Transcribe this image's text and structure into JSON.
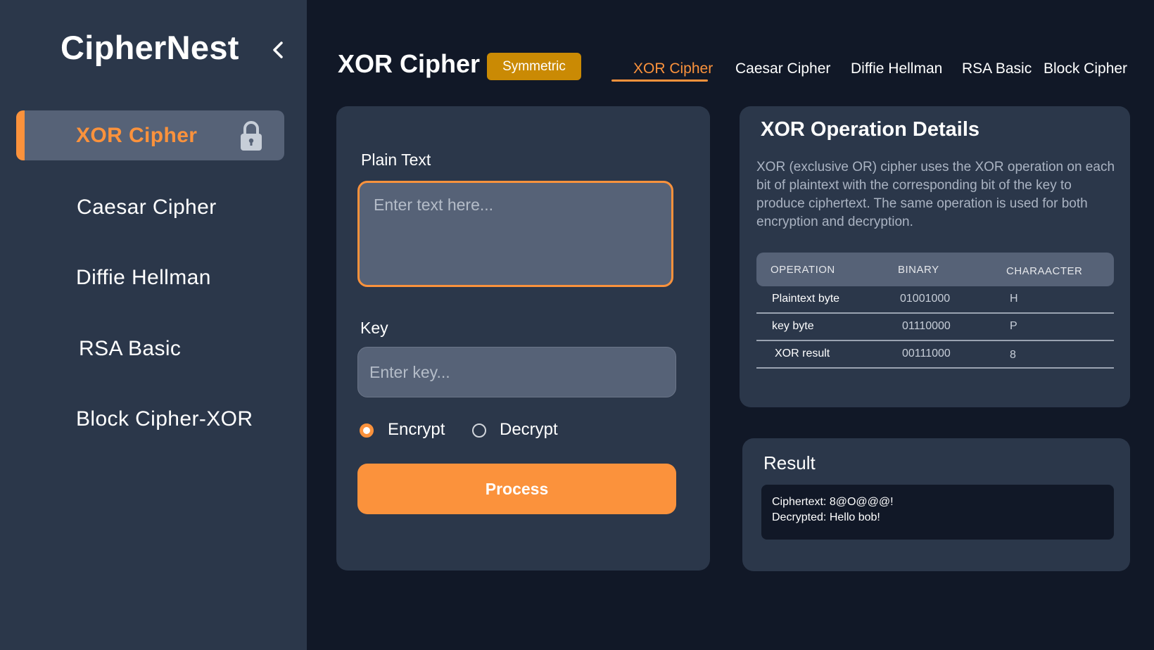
{
  "app": {
    "brand": "CipherNest"
  },
  "sidebar": {
    "items": [
      {
        "label": "XOR Cipher"
      },
      {
        "label": "Caesar Cipher"
      },
      {
        "label": "Diffie Hellman"
      },
      {
        "label": "RSA Basic"
      },
      {
        "label": "Block Cipher-XOR"
      }
    ]
  },
  "header": {
    "title": "XOR Cipher",
    "badge": "Symmetric",
    "tabs": [
      {
        "label": "XOR Cipher"
      },
      {
        "label": "Caesar Cipher"
      },
      {
        "label": "Diffie Hellman"
      },
      {
        "label": "RSA Basic"
      },
      {
        "label": "Block Cipher"
      }
    ]
  },
  "form": {
    "plain_label": "Plain Text",
    "plain_placeholder": "Enter text here...",
    "key_label": "Key",
    "key_placeholder": "Enter key...",
    "mode_selected": "Encrypt",
    "encrypt_label": "Encrypt",
    "decrypt_label": "Decrypt",
    "process_label": "Process"
  },
  "details": {
    "title": "XOR Operation Details",
    "description": "XOR (exclusive OR) cipher uses the XOR operation on each bit of plaintext with the corresponding bit of the key to produce ciphertext. The same operation is used for both encryption and decryption.",
    "columns": [
      "OPERATION",
      "BINARY",
      "CHARAACTER"
    ],
    "rows": [
      [
        "Plaintext byte",
        "01001000",
        "H"
      ],
      [
        "key byte",
        "01110000",
        "P"
      ],
      [
        "XOR result",
        "00111000",
        "8"
      ]
    ]
  },
  "result": {
    "title": "Result",
    "ciphertext": "Ciphertext: 8@O@@@!",
    "decrypted": "Decrypted: Hello bob!"
  },
  "colors": {
    "accent": "#fb923c",
    "badge": "#ca8a04",
    "background": "#111827",
    "panel": "#2b374a",
    "input": "#566277"
  }
}
